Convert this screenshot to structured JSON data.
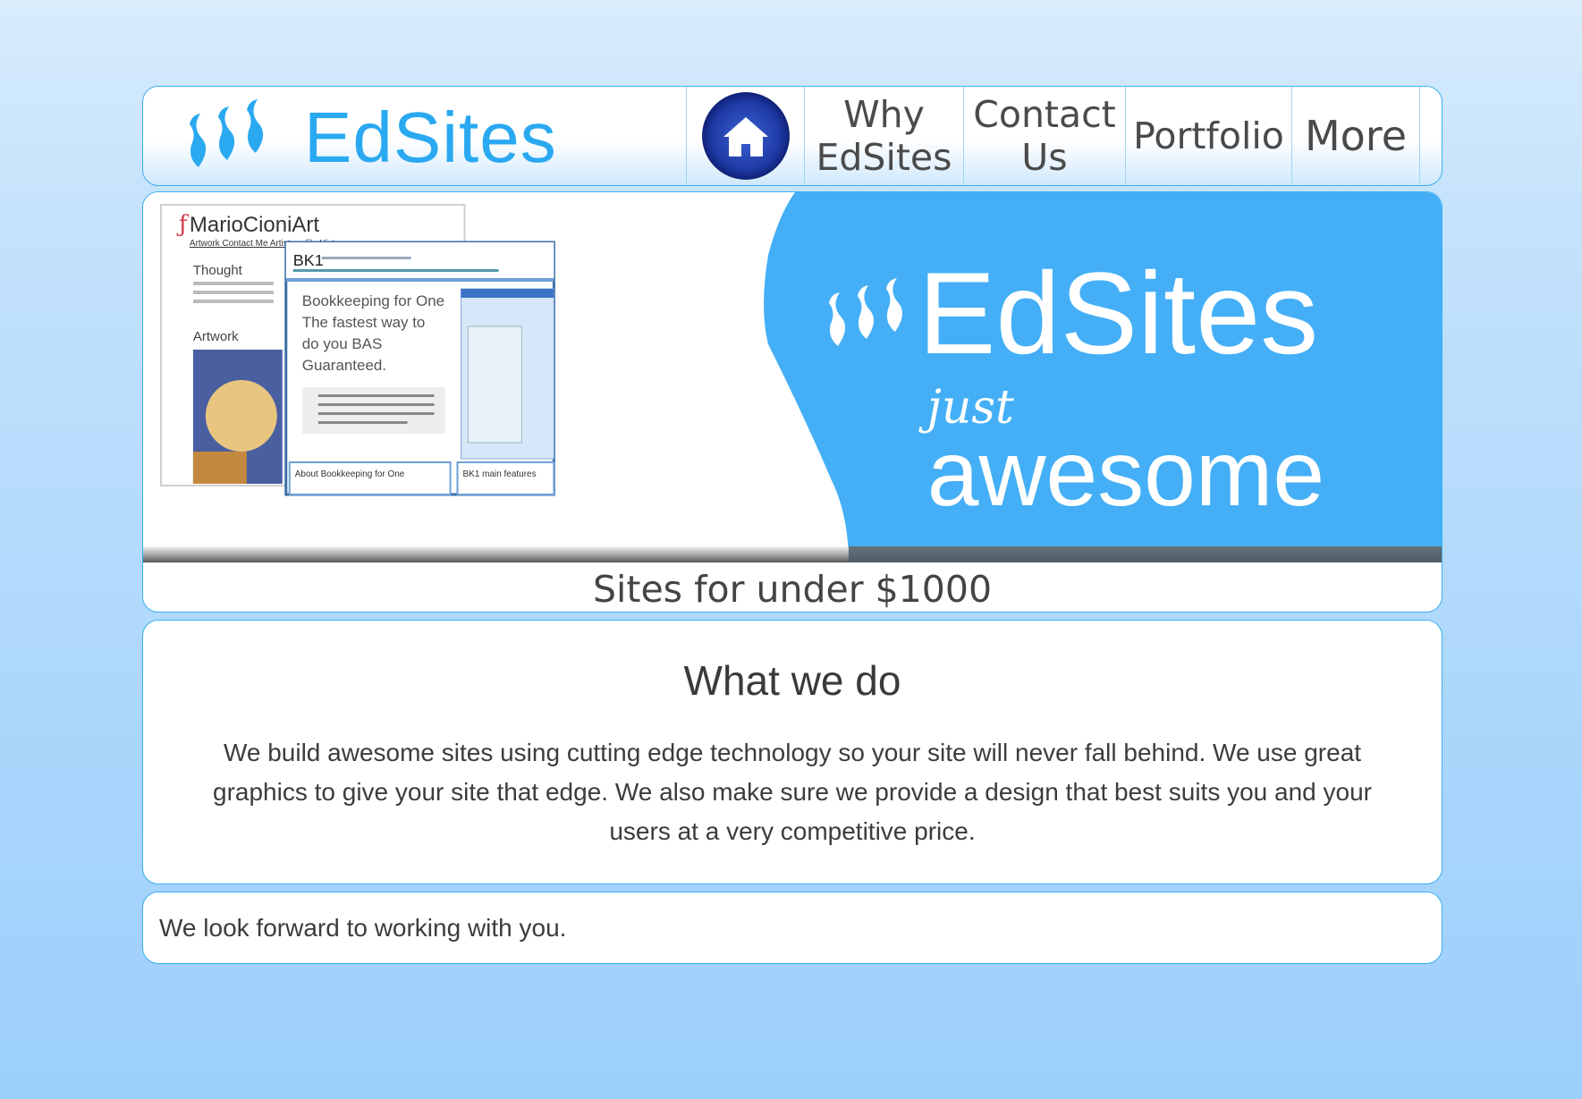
{
  "header": {
    "logo_text": "EdSites",
    "nav": [
      {
        "id": "home",
        "label": "",
        "icon": "home-icon"
      },
      {
        "id": "why",
        "line1": "Why",
        "line2": "EdSites"
      },
      {
        "id": "contact",
        "line1": "Contact",
        "line2": "Us"
      },
      {
        "id": "portfolio",
        "label": "Portfolio"
      },
      {
        "id": "more",
        "label": "More"
      }
    ]
  },
  "hero": {
    "brand": "EdSites",
    "tagline_small": "just",
    "tagline_big": "awesome",
    "screenshot_back": {
      "site_name": "MarioCioniArt",
      "nav": "Artwork  Contact Me  Artist profile  History",
      "heading1": "Thought",
      "heading2": "Artwork"
    },
    "screenshot_front": {
      "logo": "BK1",
      "headline": [
        "Bookkeeping for One",
        "The fastest way to",
        "do you BAS",
        "Guaranteed."
      ],
      "section1": "About Bookkeeping for One",
      "section2": "BK1 main features"
    },
    "caption": "Sites for under $1000",
    "colors": {
      "accent": "#44aff6",
      "brand": "#2aa9f1"
    }
  },
  "what": {
    "title": "What we do",
    "body": "We build awesome sites using cutting edge technology so your site will never fall behind. We use great graphics to give your site that edge. We also make sure we provide a design that best suits you and your users at a very competitive price."
  },
  "closing": "We look forward to working with you."
}
